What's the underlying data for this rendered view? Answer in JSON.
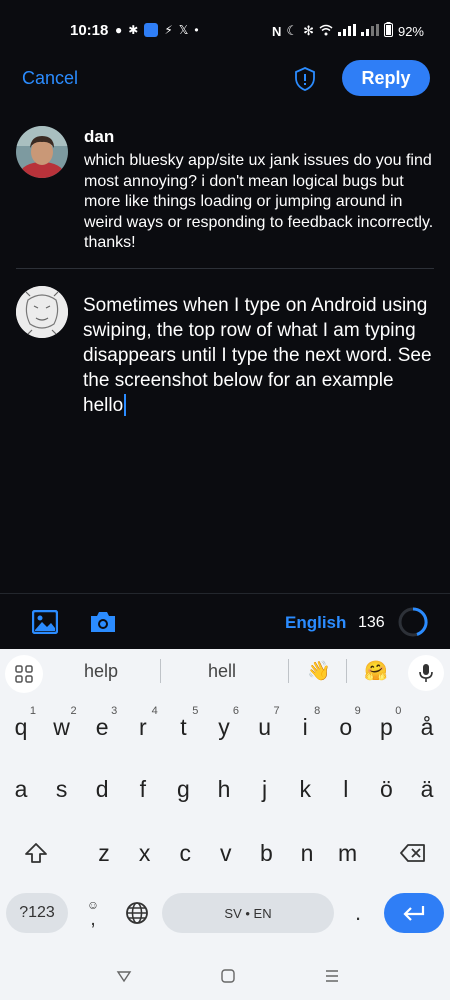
{
  "status_bar": {
    "time": "10:18",
    "battery": "92%"
  },
  "header": {
    "cancel_label": "Cancel",
    "reply_label": "Reply"
  },
  "quoted_post": {
    "author": "dan",
    "text": "which bluesky app/site ux jank issues do you find most annoying? i don't mean logical bugs but more like things loading or jumping around in weird ways or responding to feedback incorrectly. thanks!"
  },
  "compose": {
    "text": "Sometimes when I type on Android using swiping, the top row of what I am typing disappears until I type the next word. See the screenshot below for an example hello"
  },
  "toolbar": {
    "language": "English",
    "char_count": "136"
  },
  "keyboard": {
    "suggestions": [
      "help",
      "hell"
    ],
    "suggestion_emojis": [
      "👋",
      "🤗"
    ],
    "row1": [
      {
        "k": "q",
        "n": "1"
      },
      {
        "k": "w",
        "n": "2"
      },
      {
        "k": "e",
        "n": "3"
      },
      {
        "k": "r",
        "n": "4"
      },
      {
        "k": "t",
        "n": "5"
      },
      {
        "k": "y",
        "n": "6"
      },
      {
        "k": "u",
        "n": "7"
      },
      {
        "k": "i",
        "n": "8"
      },
      {
        "k": "o",
        "n": "9"
      },
      {
        "k": "p",
        "n": "0"
      },
      {
        "k": "å",
        "n": ""
      }
    ],
    "row2": [
      "a",
      "s",
      "d",
      "f",
      "g",
      "h",
      "j",
      "k",
      "l",
      "ö",
      "ä"
    ],
    "row3": [
      "z",
      "x",
      "c",
      "v",
      "b",
      "n",
      "m"
    ],
    "symbols_label": "?123",
    "emoji_label": "☺",
    "comma_label": ",",
    "space_label": "SV • EN",
    "period_label": "."
  }
}
